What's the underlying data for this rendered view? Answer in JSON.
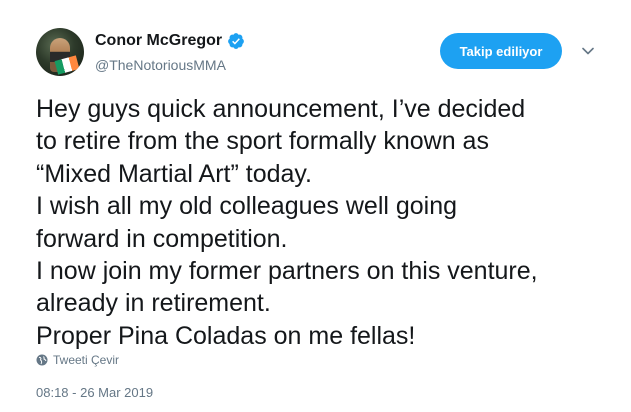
{
  "tweet": {
    "author": {
      "name": "Conor McGregor",
      "handle": "@TheNotoriousMMA",
      "verified": true
    },
    "follow_button_label": "Takip ediliyor",
    "text_lines": [
      "Hey guys quick announcement, I’ve decided",
      "to retire from the sport formally known as",
      "“Mixed Martial Art” today.",
      "I wish all my old colleagues well going",
      "forward in competition.",
      "I now join my former partners on this venture,",
      "already in retirement.",
      "Proper Pina Coladas on me fellas!"
    ],
    "translate_label": "Tweeti Çevir",
    "timestamp": "08:18 - 26 Mar 2019"
  },
  "colors": {
    "accent": "#1da1f2",
    "text": "#14171a",
    "secondary_text": "#657786"
  },
  "icons": {
    "verified": "verified-badge-icon",
    "menu": "chevron-down-icon",
    "translate": "globe-icon"
  }
}
